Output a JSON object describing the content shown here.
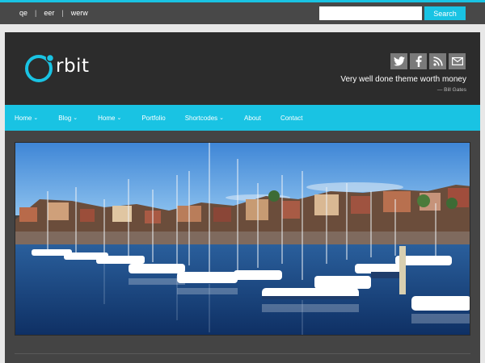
{
  "topbar": {
    "links": [
      "qe",
      "eer",
      "werw"
    ],
    "search_placeholder": "",
    "search_button": "Search"
  },
  "header": {
    "logo_text": "rbit",
    "social_icons": [
      "twitter-icon",
      "facebook-icon",
      "rss-icon",
      "email-icon"
    ],
    "tagline": "Very well done theme worth money",
    "tagline_author": "— Bill Gates"
  },
  "nav": {
    "items": [
      {
        "label": "Home",
        "dropdown": true
      },
      {
        "label": "Blog",
        "dropdown": true
      },
      {
        "label": "Home",
        "dropdown": true
      },
      {
        "label": "Portfolio",
        "dropdown": false
      },
      {
        "label": "Shortcodes",
        "dropdown": true
      },
      {
        "label": "About",
        "dropdown": false
      },
      {
        "label": "Contact",
        "dropdown": false
      }
    ]
  },
  "colors": {
    "accent": "#19c3e3",
    "topbar": "#484848",
    "header_bg": "#2c2c2c",
    "content_bg": "#444444"
  }
}
